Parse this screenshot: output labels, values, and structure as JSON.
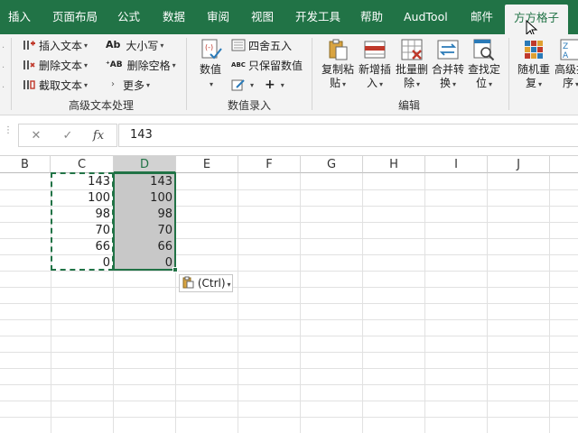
{
  "tabs": [
    {
      "label": "插入"
    },
    {
      "label": "页面布局"
    },
    {
      "label": "公式"
    },
    {
      "label": "数据"
    },
    {
      "label": "审阅"
    },
    {
      "label": "视图"
    },
    {
      "label": "开发工具"
    },
    {
      "label": "帮助"
    },
    {
      "label": "AudTool"
    },
    {
      "label": "邮件"
    },
    {
      "label": "方方格子",
      "active": true
    }
  ],
  "ribbon": {
    "text_group": {
      "insert_text": "插入文本",
      "delete_text": "删除文本",
      "extract_text": "截取文本",
      "case": "大小写",
      "case_icon": "Ab",
      "remove_spaces": "删除空格",
      "remove_spaces_icon": "AB",
      "more": "更多",
      "label": "高级文本处理"
    },
    "number_group": {
      "value": "数值",
      "round": "四舍五入",
      "keep_values": "只保留数值",
      "keep_values_icon": "ABC",
      "label": "数值录入"
    },
    "edit_group": {
      "copy_paste": [
        "复制粘",
        "贴"
      ],
      "add_insert": [
        "新增插",
        "入"
      ],
      "batch_delete": [
        "批量删",
        "除"
      ],
      "merge_convert": [
        "合并转",
        "换"
      ],
      "find_locate": [
        "查找定",
        "位"
      ],
      "label": "编辑"
    },
    "random_group": {
      "random_repeat": [
        "随机重",
        "复"
      ],
      "advanced_sort": [
        "高级排",
        "序"
      ]
    }
  },
  "formula_bar": {
    "cancel": "✕",
    "confirm": "✓",
    "fx": "fx",
    "value": "143"
  },
  "columns": [
    "B",
    "C",
    "D",
    "E",
    "F",
    "G",
    "H",
    "I",
    "J"
  ],
  "selected_column": "D",
  "cells": {
    "C": [
      "143",
      "100",
      "98",
      "70",
      "66",
      "0"
    ],
    "D": [
      "143",
      "100",
      "98",
      "70",
      "66",
      "0"
    ]
  },
  "paste_options": {
    "label": "(Ctrl)"
  },
  "colors": {
    "accent": "#217346",
    "selection": "#c8c8c8"
  }
}
